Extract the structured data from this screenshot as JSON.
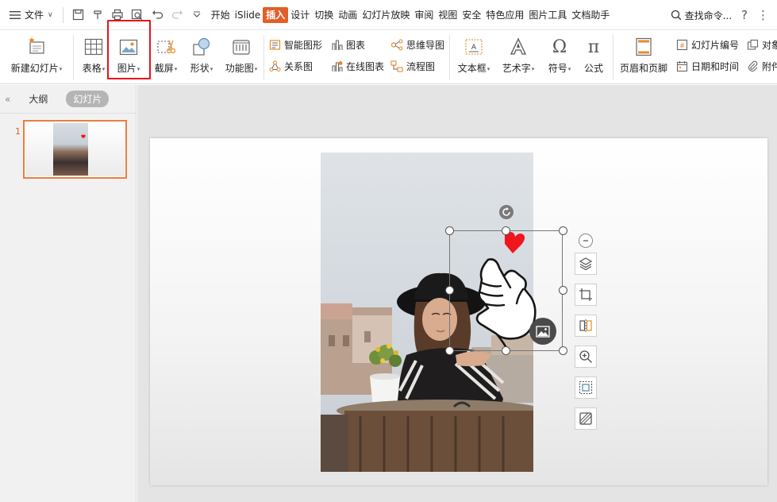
{
  "menubar": {
    "file_label": "文件",
    "tabs": [
      "开始",
      "iSlide",
      "插入",
      "设计",
      "切换",
      "动画",
      "幻灯片放映",
      "审阅",
      "视图",
      "安全",
      "特色应用",
      "图片工具",
      "文档助手"
    ],
    "active_tab": "插入",
    "search_label": "查找命令...",
    "help_glyph": "?",
    "more_glyph": "⋮"
  },
  "ribbon": {
    "new_slide": "新建幻灯片",
    "table": "表格",
    "picture": "图片",
    "screenshot": "截屏",
    "shape": "形状",
    "function_chart": "功能图",
    "smart_graphic": "智能图形",
    "chart": "图表",
    "relation_chart": "关系图",
    "online_chart": "在线图表",
    "mind_map": "思维导图",
    "flowchart": "流程图",
    "textbox": "文本框",
    "wordart": "艺术字",
    "symbol": "符号",
    "formula": "公式",
    "header_footer": "页眉和页脚",
    "slide_number": "幻灯片编号",
    "date_time": "日期和时间",
    "object": "对象",
    "attachment": "附件"
  },
  "left_panel": {
    "tab_outline": "大纲",
    "tab_slides": "幻灯片",
    "collapse_glyph": "«",
    "slide_number": "1"
  },
  "colors": {
    "accent": "#e25f29",
    "highlight": "#e5151b",
    "heart": "#f0161d"
  }
}
